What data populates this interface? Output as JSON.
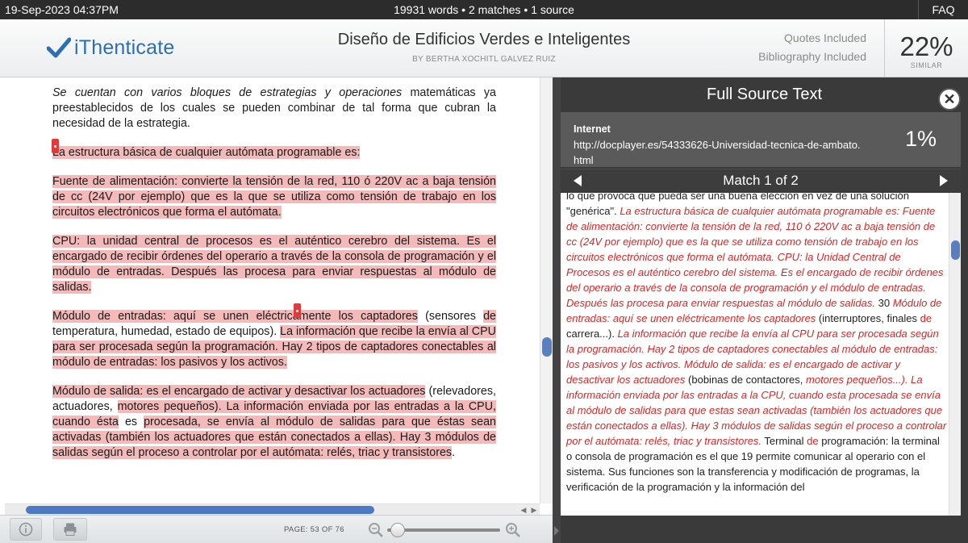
{
  "topbar": {
    "datetime": "19-Sep-2023 04:37PM",
    "stats": "19931 words • 2 matches • 1 source",
    "faq": "FAQ"
  },
  "header": {
    "logo_text": "iThenticate",
    "brand_color": "#2a6fb6",
    "title": "Diseño de Edificios Verdes e Inteligentes",
    "author": "BY BERTHA XOCHITL GALVEZ RUIZ",
    "quotes": "Quotes Included",
    "bibliography": "Bibliography Included",
    "similarity": "22%",
    "similarity_label": "SIMILAR"
  },
  "document": {
    "p1": "Se cuentan con varios bloques de estrategias y operaciones",
    "p1b": " matemáticas ya preestablecidos de los cuales se pueden combinar de tal forma que cubran la necesidad de la estrategia.",
    "p2": "La estructura básica de cualquier autómata programable es:",
    "p3": "Fuente de alimentación: convierte la tensión de la red, 110 ó 220V ac a baja tensión de cc (24V por ejemplo) que es la que se utiliza como tensión de trabajo en los circuitos electrónicos que forma el autómata.",
    "p4": "CPU: la unidad central de procesos es el auténtico cerebro del sistema. Es el encargado de recibir órdenes del operario a través de la consola de programación y el módulo de entradas. Después las procesa para enviar respuestas al módulo de salidas.",
    "p5a": "Módulo de entradas: aquí se unen eléctricamente los captadores",
    "p5b": " (sensores ",
    "p5c": "de",
    "p5d": " temperatura, humedad, estado de equipos). ",
    "p5e": "La información que recibe la envía al CPU para ser procesada según la programación. Hay 2 tipos de captadores conectables al módulo de entradas: los pasivos y los activos.",
    "p6a": "Módulo de salida: es el encargado de activar y desactivar los actuadores",
    "p6b": " (relevadores, actuadores, ",
    "p6c": "motores pequeños). La información enviada por las entradas a la CPU, cuando ésta",
    "p6d": " es ",
    "p6e": "procesada, se envía al módulo de salidas para que éstas sean activadas (también los actuadores que están conectados a ellas). Hay 3 módulos de salidas según el proceso a controlar por el autómata: relés, triac y transistores",
    "p6f": "."
  },
  "bottombar": {
    "info_icon": "info-icon",
    "print_icon": "print-icon",
    "page": "PAGE: 53 OF 76"
  },
  "source_panel": {
    "title": "Full Source Text",
    "source_type": "Internet",
    "source_url": "http://docplayer.es/54333626-Universidad-tecnica-de-ambato.html",
    "source_percent": "1%",
    "match_label": "Match 1 of 2",
    "match_color": "#e02424",
    "t1": "lo que provoca que pueda ser una buena elección en vez de una solución \"genérica\". ",
    "t2": "La estructura básica de cualquier autómata programable es: Fuente de alimentación: convierte la tensión de la red, 110 ó 220V ac a baja tensión de cc (24V por ejemplo) que es la que se utiliza como tensión de trabajo en los circuitos electrónicos que forma el autómata. CPU: la Unidad Central de Procesos es el auténtico cerebro del sistema. Es el encargado de recibir órdenes del operario a través de la consola de programación y el módulo de entradas. Después las procesa para enviar respuestas al módulo de salidas.",
    "t3": " 30 ",
    "t4": "Módulo de entradas: aquí se unen eléctricamente los captadores",
    "t5": " (interruptores, finales ",
    "t6": "de",
    "t7": " carrera...). ",
    "t8": "La información que recibe la envía al CPU para ser procesada según la programación. Hay 2 tipos de captadores conectables al módulo de entradas: los pasivos y los activos. Módulo de salida: es el encargado de activar y desactivar los actuadores",
    "t9": " (bobinas de contactores, ",
    "t10": "motores pequeños...). La información enviada por las entradas a la CPU, cuando esta procesada se envía al módulo de salidas para que estas sean activadas (también los actuadores que están conectados a ellas). Hay 3 módulos de salidas según el proceso a controlar por el autómata: relés, triac y transistores.",
    "t11": " Terminal ",
    "t12": "de",
    "t13": " programación: la terminal o consola de programación es el que 19 permite comunicar al operario con el sistema. Sus funciones son la transferencia y modificación de programas, la verificación de la programación y la información del"
  }
}
